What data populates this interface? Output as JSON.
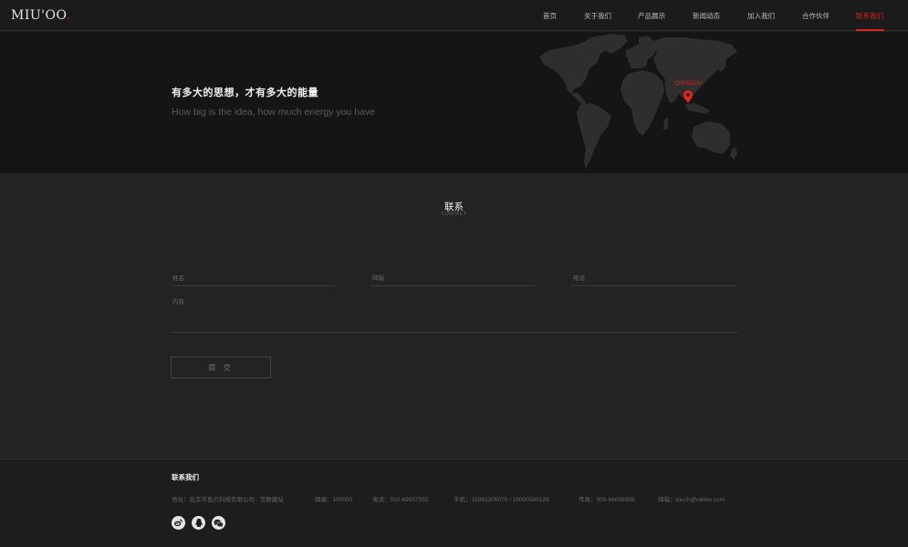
{
  "header": {
    "logo_text": "MIU'OO",
    "logo_dot": ".",
    "nav": [
      {
        "label": "首页"
      },
      {
        "label": "关于我们"
      },
      {
        "label": "产品展示"
      },
      {
        "label": "新闻动态"
      },
      {
        "label": "加入我们"
      },
      {
        "label": "合作伙伴"
      },
      {
        "label": "联系我们",
        "active": true
      }
    ]
  },
  "hero": {
    "title": "有多大的思想，才有多大的能量",
    "subtitle": "How big is the idea, how much energy you have",
    "map_pin_label": "CHENGDU"
  },
  "contact": {
    "title": "联系",
    "subtitle": "CONTACT",
    "fields": {
      "name_placeholder": "姓名",
      "email_placeholder": "邮箱",
      "phone_placeholder": "电话",
      "content_placeholder": "内容"
    },
    "submit_label": "提 交"
  },
  "footer": {
    "title": "联系我们",
    "address": "地址：北京市鱼爪科技有限公司 · 互联建站",
    "postcode": "邮编：100000",
    "tel": "电话：010-69557550",
    "mobile": "手机：15982305070 / 18000580129",
    "fax": "传真：000-66668888",
    "email": "邮箱：touch@uelike.com"
  },
  "colors": {
    "accent": "#d6231b",
    "background": "#232323",
    "hero_background": "#151515"
  },
  "icons": [
    "map-pin-icon",
    "weibo-icon",
    "qq-icon",
    "wechat-icon"
  ]
}
